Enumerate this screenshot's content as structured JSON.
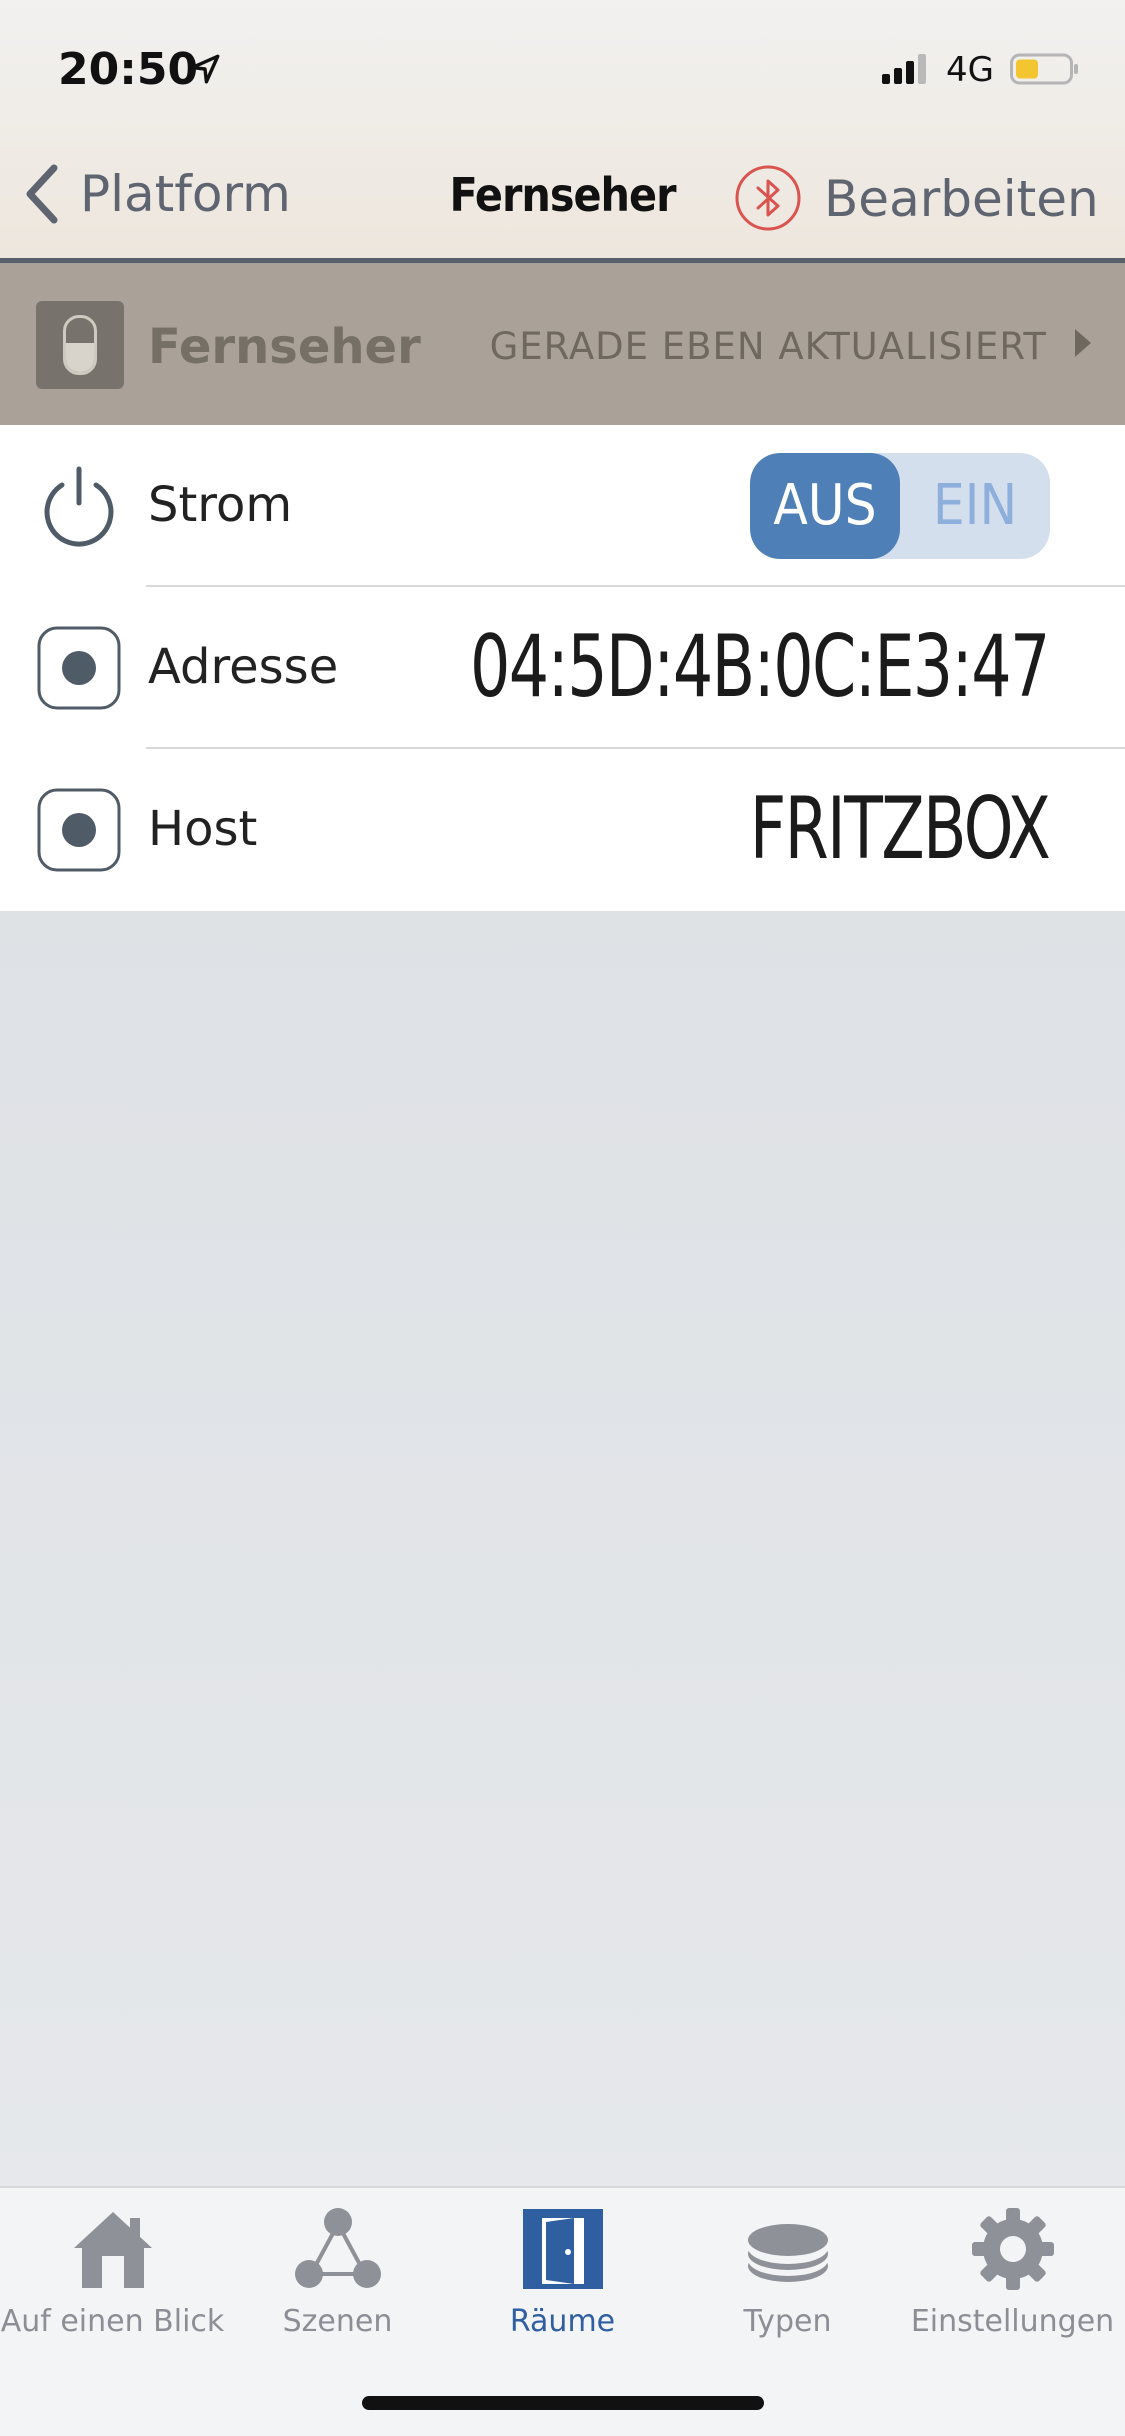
{
  "status_bar": {
    "time": "20:50",
    "network": "4G"
  },
  "nav": {
    "back_label": "Platform",
    "title": "Fernseher",
    "edit_label": "Bearbeiten"
  },
  "accessory": {
    "name": "Fernseher",
    "status": "GERADE EBEN AKTUALISIERT"
  },
  "rows": [
    {
      "label": "Strom",
      "toggle": {
        "off_label": "AUS",
        "on_label": "EIN",
        "selected": "AUS"
      }
    },
    {
      "label": "Adresse",
      "value": "04:5D:4B:0C:E3:47"
    },
    {
      "label": "Host",
      "value": "FRITZBOX"
    }
  ],
  "tabs": [
    {
      "label": "Auf einen Blick",
      "icon": "house-icon"
    },
    {
      "label": "Szenen",
      "icon": "scenes-icon"
    },
    {
      "label": "Räume",
      "icon": "door-icon",
      "active": true
    },
    {
      "label": "Typen",
      "icon": "layers-icon"
    },
    {
      "label": "Einstellungen",
      "icon": "gear-icon"
    }
  ],
  "colors": {
    "accent": "#4f7fb7",
    "tab_active": "#2f5ea1",
    "bluetooth": "#d9534f"
  }
}
